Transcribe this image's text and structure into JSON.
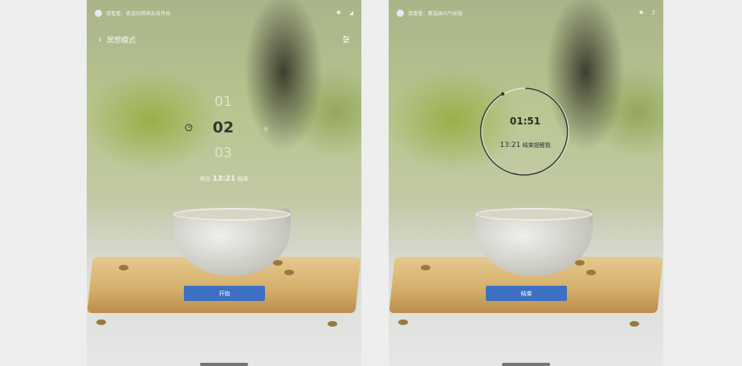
{
  "left_screen": {
    "status": {
      "text": "请看看：茶道的精神及其传统",
      "icons": [
        "bluetooth-icon",
        "signal-icon"
      ]
    },
    "header": {
      "title": "冥想模式"
    },
    "picker": {
      "above": "01",
      "selected": "02",
      "below": "03"
    },
    "hint": {
      "prefix": "将在",
      "time": "13:21",
      "suffix": "结束"
    },
    "button": {
      "label": "开始"
    }
  },
  "right_screen": {
    "status": {
      "text": "请看看：精选国内气候版",
      "icons": [
        "bluetooth-icon"
      ],
      "number": "2"
    },
    "countdown": "01:51",
    "end": {
      "time": "13:21",
      "suffix": "结束提醒我"
    },
    "button": {
      "label": "结束"
    }
  },
  "colors": {
    "accent": "#3d70c2",
    "text_dark": "#2f3a2e",
    "overlay_text": "#f4f4ef"
  }
}
